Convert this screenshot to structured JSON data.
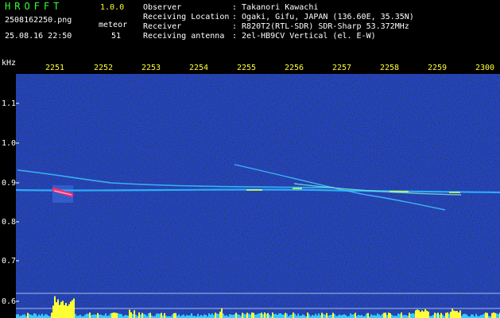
{
  "header": {
    "brand": "HROFFT",
    "version": "1.0.0",
    "filename": "2508162250.png",
    "observation_type": "meteor",
    "datetime": "25.08.16 22:50",
    "count": "51"
  },
  "info": [
    {
      "label": "Observer",
      "value": ": Takanori Kawachi"
    },
    {
      "label": "Receiving Location",
      "value": ": Ogaki, Gifu, JAPAN (136.60E, 35.35N)"
    },
    {
      "label": "Receiver",
      "value": ": R820T2(RTL-SDR) SDR-Sharp 53.372MHz"
    },
    {
      "label": "Receiving antenna",
      "value": ": 2el-HB9CV Vertical (el. E-W)"
    }
  ],
  "axes": {
    "y_unit": "kHz",
    "y_ticks": [
      "1.1",
      "1.0",
      "0.9",
      "0.8",
      "0.7",
      "0.6"
    ],
    "x_ticks": [
      "2251",
      "2252",
      "2253",
      "2254",
      "2255",
      "2256",
      "2257",
      "2258",
      "2259",
      "2300"
    ]
  },
  "colors": {
    "background": "#000000",
    "text": "#ffffff",
    "brand": "#33ff33",
    "time_ticks": "#ffff33",
    "noise": "#0a1a7a",
    "trace": "#33ccff",
    "echo": "#ff3366"
  }
}
